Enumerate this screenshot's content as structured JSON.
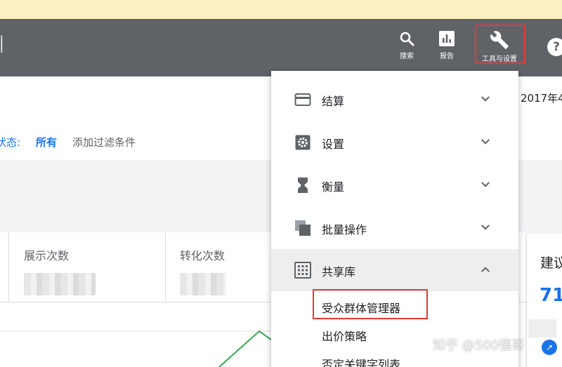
{
  "header": {
    "title_glyph": "l",
    "nav": {
      "search_label": "搜索",
      "report_label": "报告",
      "tools_label": "工具与设置",
      "help_label": "?"
    }
  },
  "filter_bar": {
    "date": "2017年4",
    "status_label": "状态:",
    "status_value": "所有",
    "add_filter": "添加过滤条件"
  },
  "stats": [
    {
      "label": "展示次数"
    },
    {
      "label": "转化次数"
    }
  ],
  "side_card": {
    "title": "建议",
    "number": "71"
  },
  "menu": {
    "items": [
      {
        "label": "结算",
        "icon": "card-icon",
        "expanded": false
      },
      {
        "label": "设置",
        "icon": "settings-icon",
        "expanded": false
      },
      {
        "label": "衡量",
        "icon": "hourglass-icon",
        "expanded": false
      },
      {
        "label": "批量操作",
        "icon": "copy-icon",
        "expanded": false
      },
      {
        "label": "共享库",
        "icon": "grid-icon",
        "expanded": true
      }
    ],
    "subitems": [
      {
        "label": "受众群体管理器",
        "highlighted": true
      },
      {
        "label": "出价策略"
      },
      {
        "label": "否定关键字列表"
      }
    ]
  },
  "watermark": "知乎 @500强哥",
  "colors": {
    "topbar": "#5f6368",
    "notice": "#fcefc2",
    "accent_blue": "#1a73e8",
    "highlight_red": "#e53935",
    "chart_line": "#34a853"
  }
}
